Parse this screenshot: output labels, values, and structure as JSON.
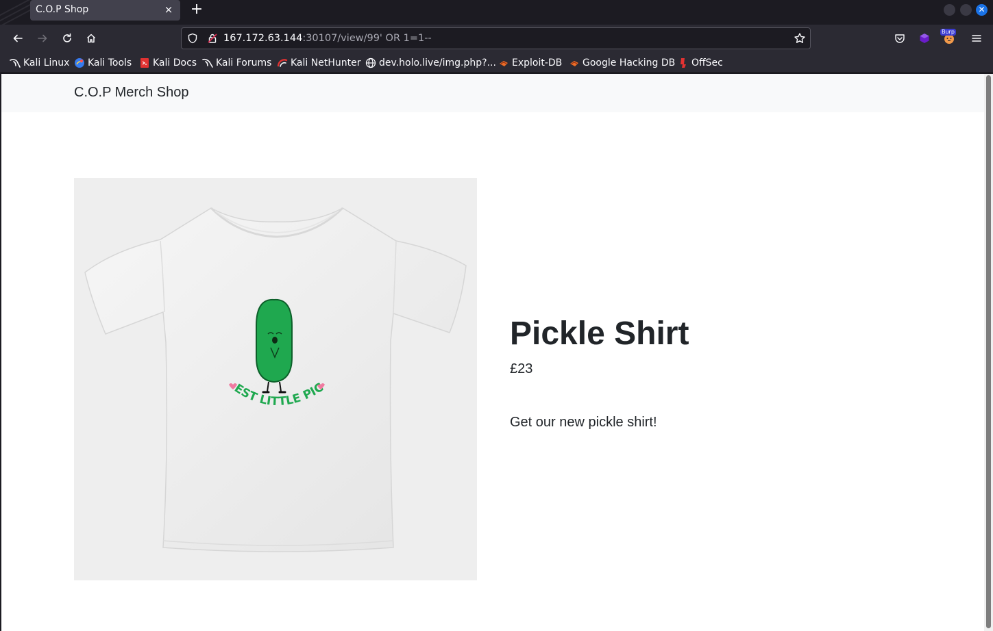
{
  "browser": {
    "tab": {
      "title": "C.O.P Shop",
      "close_glyph": "×"
    },
    "new_tab_glyph": "+",
    "url": {
      "host": "167.172.63.144",
      "rest": ":30107/view/99' OR 1=1--"
    },
    "extensions": {
      "burp_label": "Burp"
    },
    "bookmarks": [
      {
        "label": "Kali Linux",
        "icon": "kali-dragon-icon"
      },
      {
        "label": "Kali Tools",
        "icon": "kali-tools-icon"
      },
      {
        "label": "Kali Docs",
        "icon": "kali-docs-icon"
      },
      {
        "label": "Kali Forums",
        "icon": "kali-dragon-icon"
      },
      {
        "label": "Kali NetHunter",
        "icon": "nethunter-icon"
      },
      {
        "label": "dev.holo.live/img.php?...",
        "icon": "globe-icon"
      },
      {
        "label": "Exploit-DB",
        "icon": "exploit-db-icon"
      },
      {
        "label": "Google Hacking DB",
        "icon": "exploit-db-icon"
      },
      {
        "label": "OffSec",
        "icon": "offsec-icon"
      }
    ]
  },
  "page": {
    "brand": "C.O.P Merch Shop",
    "product": {
      "title": "Pickle Shirt",
      "price": "£23",
      "description": "Get our new pickle shirt!",
      "shirt_print_text": "CUTEST LITTLE PICKLE"
    }
  },
  "colors": {
    "pickle_green": "#1fa84f",
    "text_dark": "#212529",
    "header_bg": "#f8f9fa"
  }
}
